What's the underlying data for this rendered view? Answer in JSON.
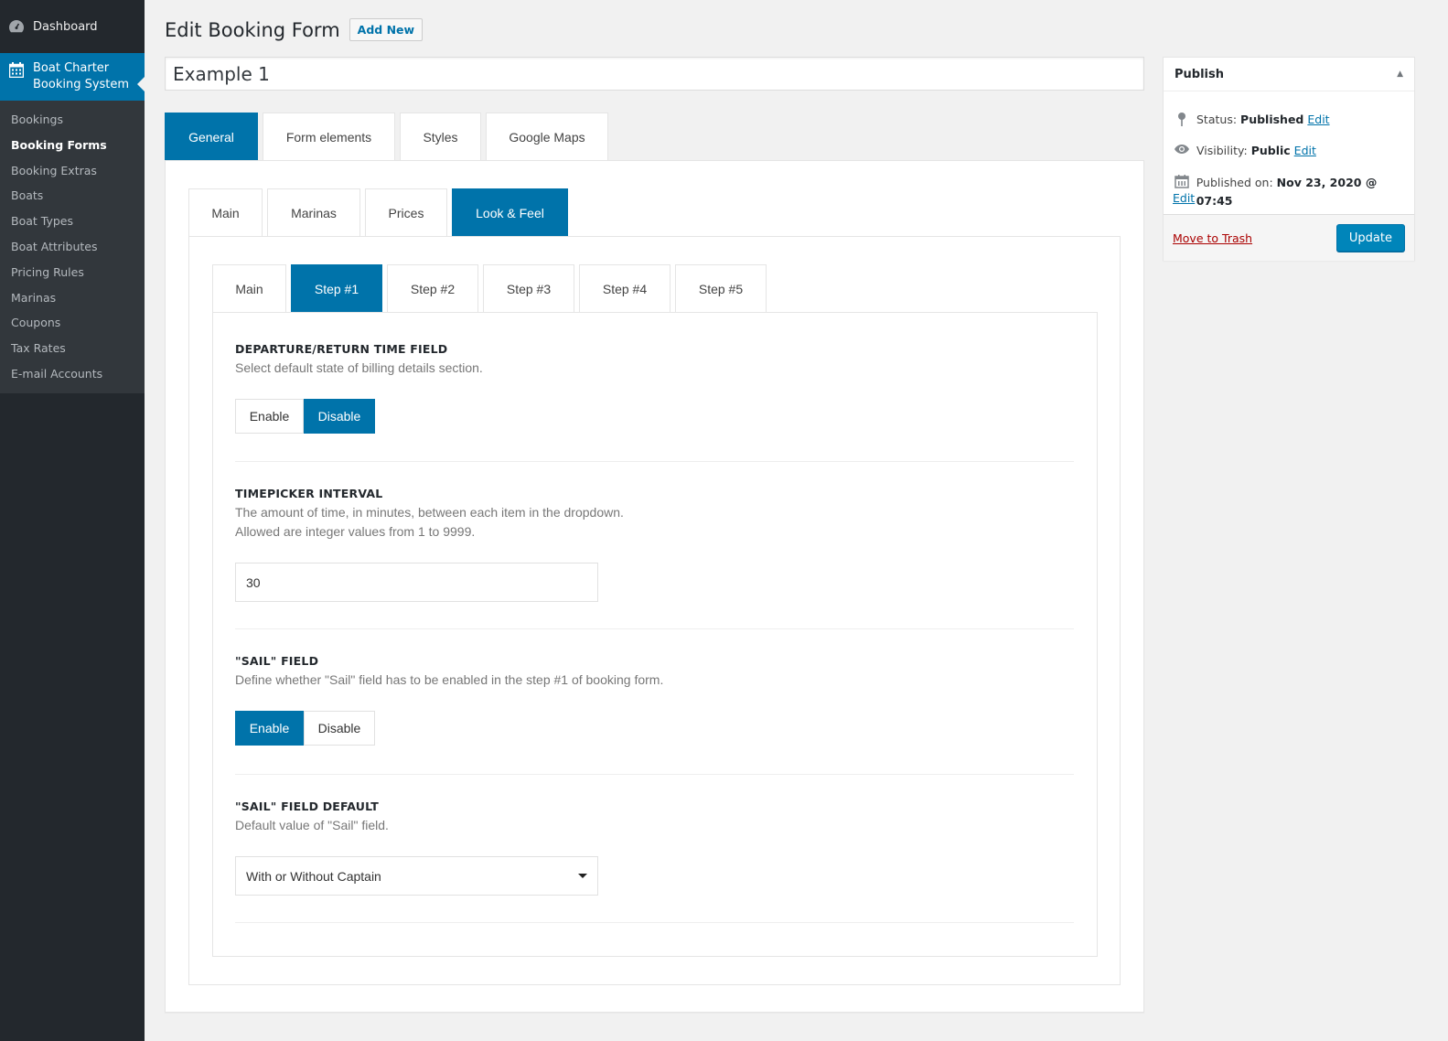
{
  "sidebar": {
    "dashboard_label": "Dashboard",
    "plugin_label_line1": "Boat Charter",
    "plugin_label_line2": "Booking System",
    "items": [
      {
        "label": "Bookings"
      },
      {
        "label": "Booking Forms",
        "current": true
      },
      {
        "label": "Booking Extras"
      },
      {
        "label": "Boats"
      },
      {
        "label": "Boat Types"
      },
      {
        "label": "Boat Attributes"
      },
      {
        "label": "Pricing Rules"
      },
      {
        "label": "Marinas"
      },
      {
        "label": "Coupons"
      },
      {
        "label": "Tax Rates"
      },
      {
        "label": "E-mail Accounts"
      }
    ]
  },
  "header": {
    "title": "Edit Booking Form",
    "add_new_label": "Add New"
  },
  "form_title": "Example 1",
  "tabs_level1": [
    {
      "label": "General",
      "active": true
    },
    {
      "label": "Form elements"
    },
    {
      "label": "Styles"
    },
    {
      "label": "Google Maps"
    }
  ],
  "tabs_level2": [
    {
      "label": "Main"
    },
    {
      "label": "Marinas"
    },
    {
      "label": "Prices"
    },
    {
      "label": "Look & Feel",
      "active": true
    }
  ],
  "tabs_level3": [
    {
      "label": "Main"
    },
    {
      "label": "Step #1",
      "active": true
    },
    {
      "label": "Step #2"
    },
    {
      "label": "Step #3"
    },
    {
      "label": "Step #4"
    },
    {
      "label": "Step #5"
    }
  ],
  "fields": {
    "departure_return": {
      "title": "DEPARTURE/RETURN TIME FIELD",
      "description": "Select default state of billing details section.",
      "options": [
        "Enable",
        "Disable"
      ],
      "selected": "Disable"
    },
    "timepicker": {
      "title": "TIMEPICKER INTERVAL",
      "description_line1": "The amount of time, in minutes, between each item in the dropdown.",
      "description_line2": "Allowed are integer values from 1 to 9999.",
      "value": "30"
    },
    "sail": {
      "title": "\"SAIL\" FIELD",
      "description": "Define whether \"Sail\" field has to be enabled in the step #1 of booking form.",
      "options": [
        "Enable",
        "Disable"
      ],
      "selected": "Enable"
    },
    "sail_default": {
      "title": "\"SAIL\" FIELD DEFAULT",
      "description": "Default value of \"Sail\" field.",
      "selected_value": "With or Without Captain"
    }
  },
  "publish": {
    "title": "Publish",
    "status_label": "Status:",
    "status_value": "Published",
    "visibility_label": "Visibility:",
    "visibility_value": "Public",
    "published_on_label": "Published on:",
    "published_on_value": "Nov 23, 2020 @ 07:45",
    "edit_label": "Edit",
    "trash_label": "Move to Trash",
    "update_label": "Update"
  },
  "colors": {
    "accent": "#0073aa",
    "sidebar_bg": "#23282d",
    "submenu_bg": "#32373c",
    "trash": "#a00000"
  }
}
